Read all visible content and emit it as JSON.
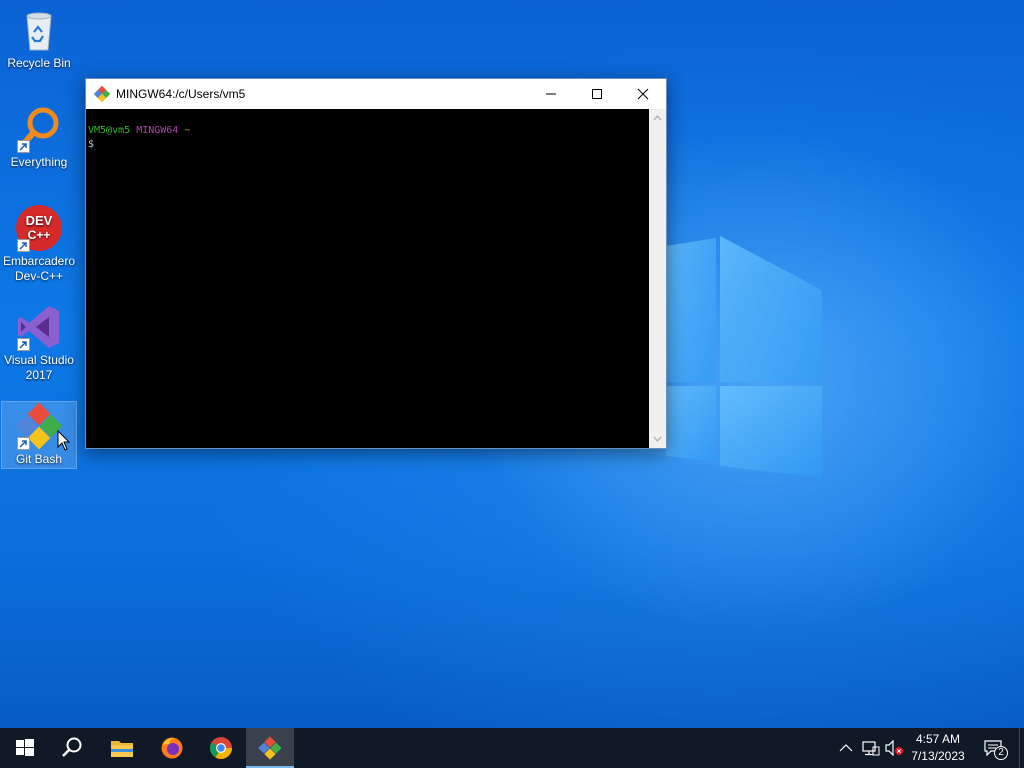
{
  "desktop": {
    "icons": [
      {
        "label": "Recycle Bin"
      },
      {
        "label": "Everything"
      },
      {
        "label": "Embarcadero Dev-C++",
        "badge": "DEV C++"
      },
      {
        "label": "Visual Studio 2017"
      },
      {
        "label": "Git Bash"
      }
    ]
  },
  "window": {
    "title": "MINGW64:/c/Users/vm5",
    "terminal": {
      "user_host": "VM5@vm5",
      "shell": "MINGW64",
      "path": "~",
      "prompt": "$"
    }
  },
  "taskbar": {
    "apps": [
      "start-icon",
      "search-icon",
      "file-explorer-icon",
      "firefox-icon",
      "chrome-icon",
      "git-bash-icon"
    ],
    "clock_time": "4:57 AM",
    "clock_date": "7/13/2023",
    "notification_count": "2"
  },
  "colors": {
    "prompt_user": "#2fb82f",
    "prompt_shell": "#b040b0",
    "prompt_path": "#b0a030",
    "taskbar_bg": "#101a26"
  }
}
